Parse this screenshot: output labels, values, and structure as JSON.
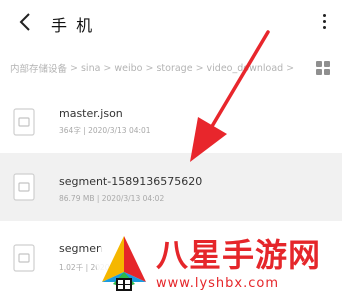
{
  "header": {
    "title": "手 机"
  },
  "breadcrumb": [
    "内部存储设备",
    "sina",
    "weibo",
    "storage",
    "video_download"
  ],
  "files": [
    {
      "name": "master.json",
      "meta": "364字 | 2020/3/13 04:01"
    },
    {
      "name": "segment-1589136575620",
      "meta": "86.79 MB | 2020/3/13 04:02"
    },
    {
      "name": "segmen",
      "meta": "1.02千 | 2020/3/13"
    }
  ],
  "watermark": {
    "title": "八星手游网",
    "url": "www.lyshbx.com"
  },
  "colors": {
    "arrow": "#e8262c",
    "selected_row": "#f1f1f1"
  }
}
